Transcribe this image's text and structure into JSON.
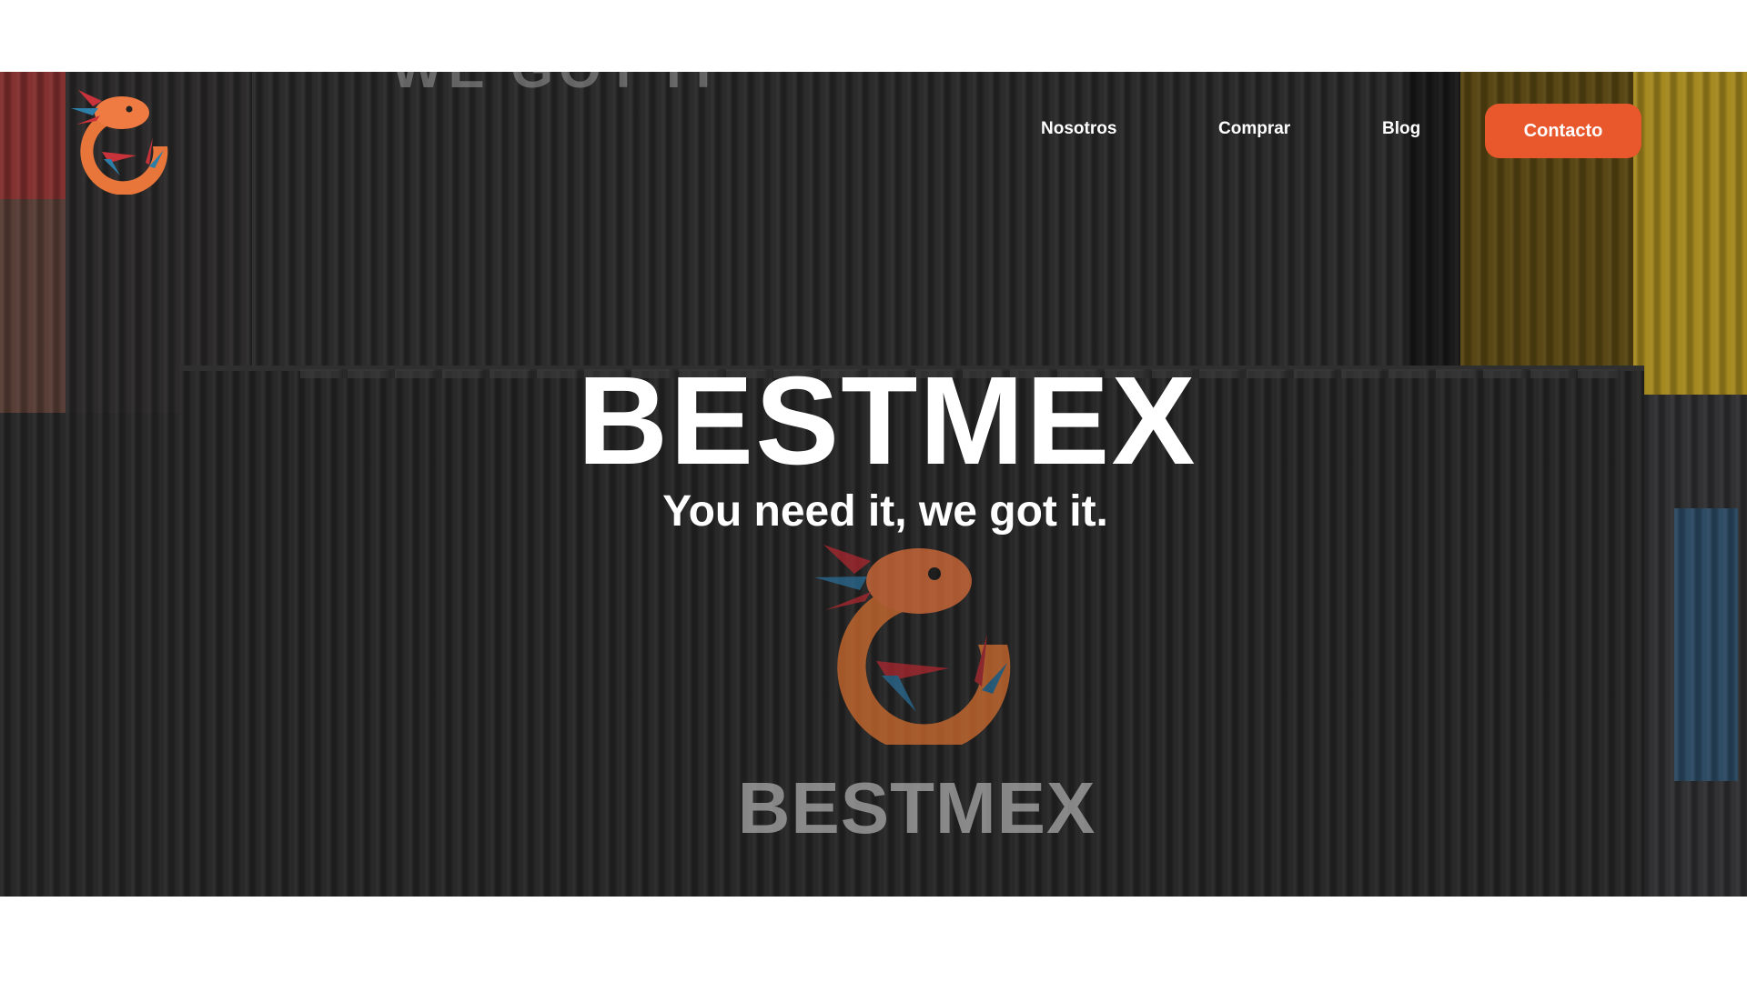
{
  "nav": {
    "items": [
      {
        "label": "Nosotros"
      },
      {
        "label": "Comprar"
      },
      {
        "label": "Blog"
      }
    ],
    "cta_label": "Contacto"
  },
  "hero": {
    "title": "BESTMEX",
    "tagline": "You need it, we got it."
  },
  "background": {
    "painted_text_top": "WE GOT IT",
    "painted_brand": "BESTMEX"
  },
  "icons": {
    "logo": "axolotl-logo-icon",
    "emblem": "axolotl-emblem-icon"
  },
  "colors": {
    "accent": "#e8582c",
    "logo_orange": "#e8753a",
    "logo_red": "#c8323a",
    "logo_blue": "#2e7fa8"
  }
}
